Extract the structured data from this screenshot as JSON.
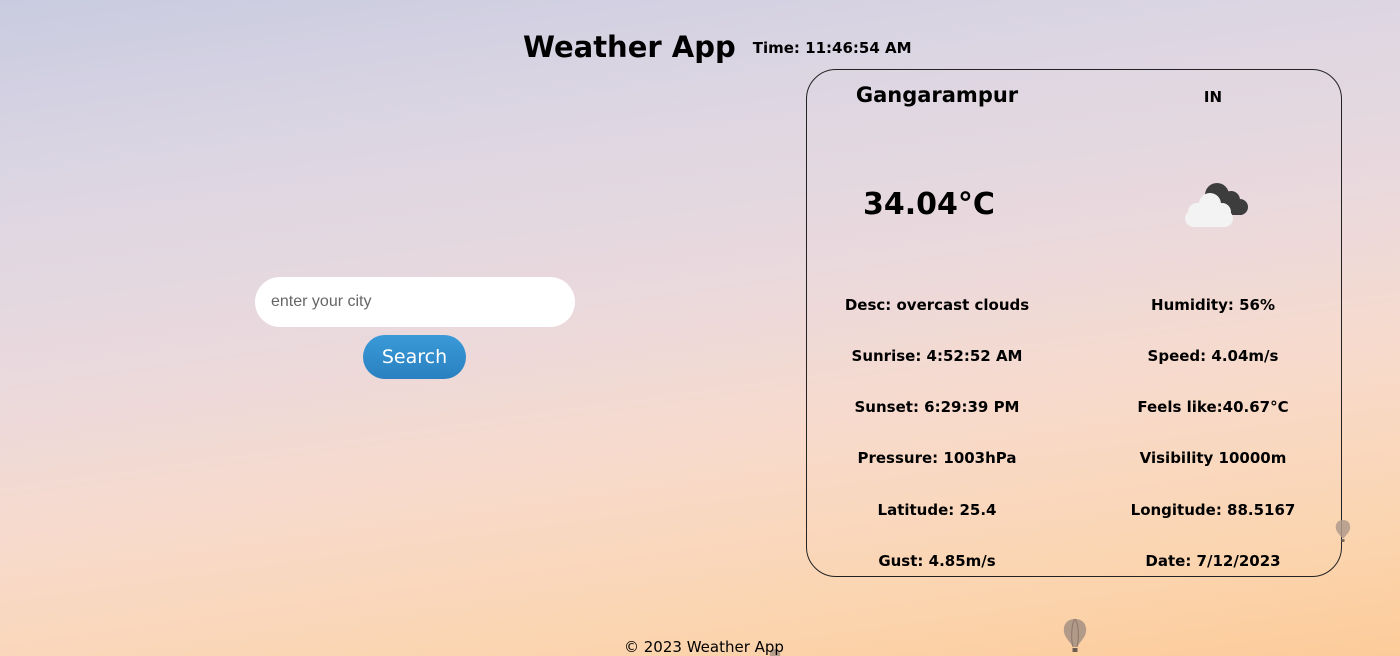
{
  "header": {
    "title": "Weather App",
    "time_label": "Time:",
    "time_value": "11:46:54 AM"
  },
  "search": {
    "placeholder": "enter your city",
    "value": "",
    "button_label": "Search"
  },
  "weather": {
    "city": "Gangarampur",
    "country": "IN",
    "temperature": "34.04°C",
    "icon": "cloud-icon",
    "details_left": [
      "Desc: overcast clouds",
      "Sunrise: 4:52:52 AM",
      "Sunset: 6:29:39 PM",
      "Pressure: 1003hPa",
      "Latitude: 25.4",
      "Gust: 4.85m/s"
    ],
    "details_right": [
      "Humidity: 56%",
      "Speed: 4.04m/s",
      "Feels like:40.67°C",
      "Visibility 10000m",
      "Longitude: 88.5167",
      "Date: 7/12/2023"
    ]
  },
  "footer": {
    "text": "© 2023 Weather App"
  },
  "colors": {
    "button": "#2e8ccf",
    "card_border": "#222222",
    "background_top": "#c9cbe0",
    "background_bottom": "#fccb99"
  }
}
